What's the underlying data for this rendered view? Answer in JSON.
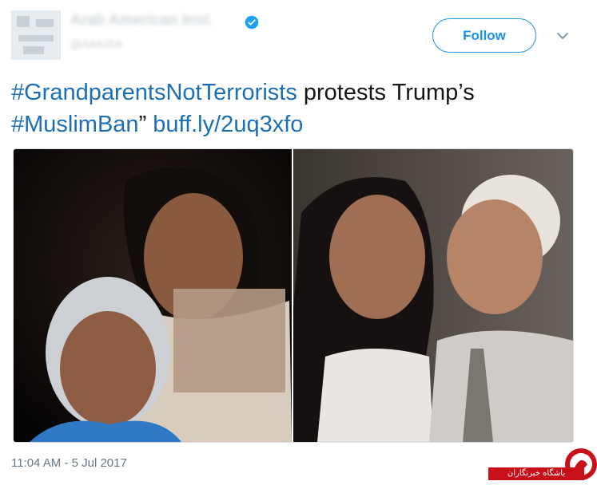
{
  "header": {
    "display_name": "Arab American Inst.",
    "handle": "@AAIUSA",
    "follow_label": "Follow",
    "verified_icon": "verified-icon",
    "caret_icon": "chevron-down-icon"
  },
  "tweet": {
    "hashtag1": "#GrandparentsNotTerrorists",
    "text1": " protests Trump’s ",
    "hashtag2": "#MuslimBan",
    "text2": "” ",
    "link": "buff.ly/2uq3xfo",
    "timestamp": "11:04 AM - 5 Jul 2017"
  },
  "watermark": {
    "text": "باشگاه خبرنگاران"
  },
  "colors": {
    "accent": "#1b95e0",
    "hashtag": "#1b6fb2",
    "text": "#14171a",
    "muted": "#657786",
    "watermark": "#c8101a"
  }
}
